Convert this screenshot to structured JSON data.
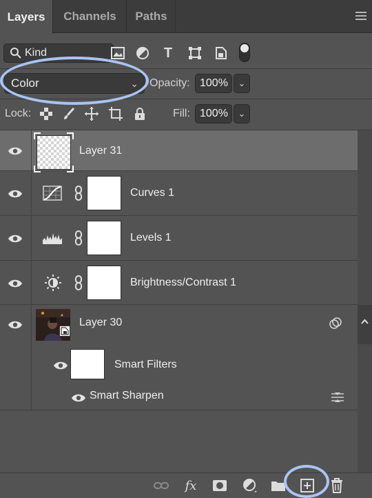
{
  "tabs": [
    {
      "label": "Layers",
      "active": true
    },
    {
      "label": "Channels",
      "active": false
    },
    {
      "label": "Paths",
      "active": false
    }
  ],
  "filter": {
    "kind_label": "Kind",
    "icons": [
      "image-filter-icon",
      "adjustment-filter-icon",
      "type-filter-icon",
      "shape-filter-icon",
      "smart-object-filter-icon",
      "filter-toggle-icon"
    ]
  },
  "blend": {
    "mode": "Color",
    "opacity_label": "Opacity:",
    "opacity_value": "100%"
  },
  "lock": {
    "label": "Lock:",
    "icons": [
      "lock-transparent-pixels-icon",
      "lock-image-pixels-icon",
      "lock-position-icon",
      "lock-artboard-icon",
      "lock-all-icon"
    ],
    "fill_label": "Fill:",
    "fill_value": "100%"
  },
  "layers": [
    {
      "name": "Layer 31",
      "selected": true,
      "type": "pixel",
      "icon": "transparent-thumbnail"
    },
    {
      "name": "Curves 1",
      "selected": false,
      "type": "adjustment",
      "icon": "curves-icon"
    },
    {
      "name": "Levels 1",
      "selected": false,
      "type": "adjustment",
      "icon": "levels-icon"
    },
    {
      "name": "Brightness/Contrast 1",
      "selected": false,
      "type": "adjustment",
      "icon": "brightness-contrast-icon"
    },
    {
      "name": "Layer 30",
      "selected": false,
      "type": "smart-object",
      "icon": "photo-thumbnail"
    }
  ],
  "smart_filters": {
    "label": "Smart Filters",
    "items": [
      {
        "name": "Smart Sharpen"
      }
    ]
  },
  "bottom_bar": {
    "icons": [
      "link-layers-icon",
      "fx-icon",
      "add-mask-icon",
      "new-adjustment-icon",
      "new-group-icon",
      "new-layer-icon",
      "delete-layer-icon"
    ],
    "fx_label": "fx"
  },
  "colors": {
    "panel": "#535353",
    "tab_bar": "#3c3c3c",
    "selected_row": "#6d6d6d",
    "annotation": "#a8c4f6"
  }
}
